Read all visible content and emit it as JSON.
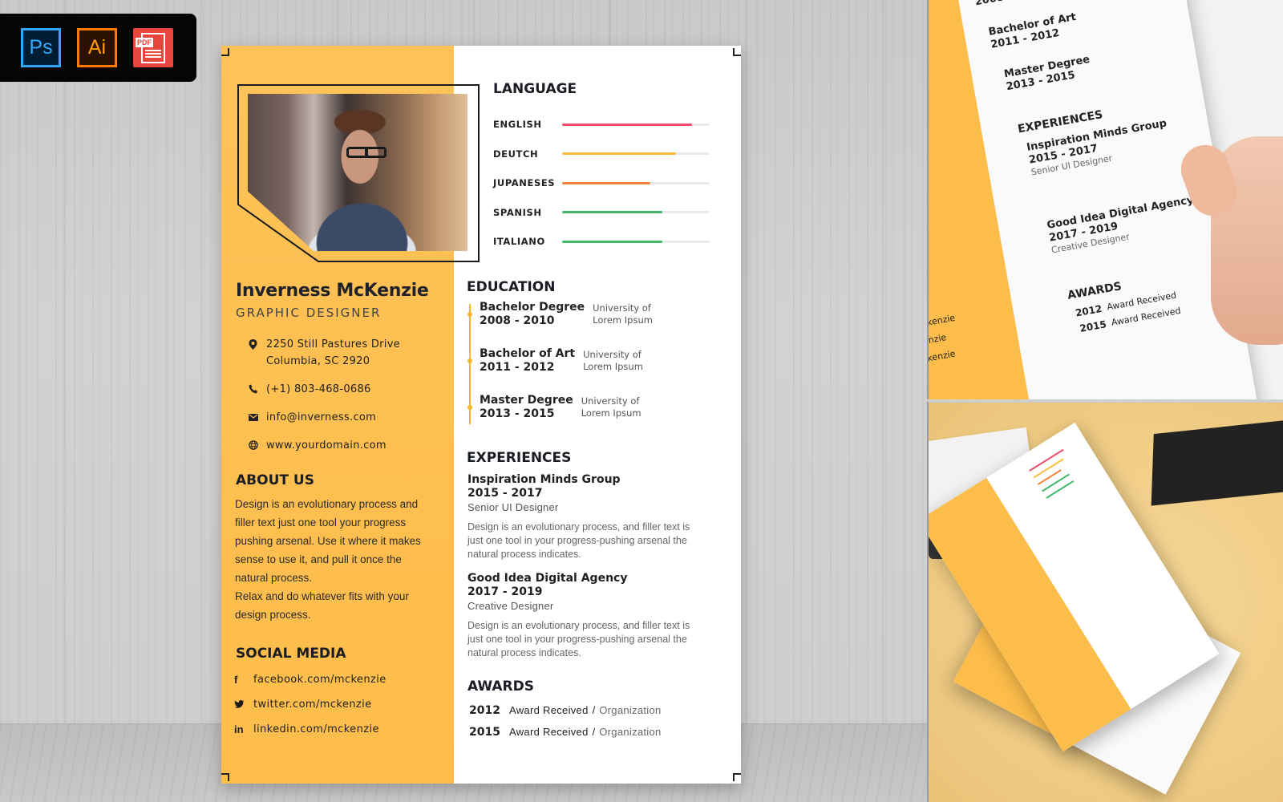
{
  "software_badges": [
    {
      "label": "Ps",
      "name": "photoshop",
      "color": "#31a8ff"
    },
    {
      "label": "Ai",
      "name": "illustrator",
      "color": "#ff9a00"
    },
    {
      "label": "PDF",
      "name": "pdf",
      "color": "#e8453c"
    }
  ],
  "resume": {
    "name": "Inverness McKenzie",
    "role": "GRAPHIC DESIGNER",
    "contact": {
      "address": "2250 Still Pastures Drive\nColumbia, SC 2920",
      "phone": "(+1) 803-468-0686",
      "email": "info@inverness.com",
      "website": "www.yourdomain.com"
    },
    "about": {
      "heading": "ABOUT US",
      "paragraph1": "Design is an evolutionary process and filler text just one tool your progress pushing arsenal. Use it where it makes sense to use it, and pull it once the natural process.",
      "paragraph2": "Relax and do whatever fits with your design process."
    },
    "social": {
      "heading": "SOCIAL MEDIA",
      "items": [
        {
          "icon": "facebook-icon",
          "glyph": "f",
          "label": "facebook.com/mckenzie"
        },
        {
          "icon": "twitter-icon",
          "glyph": "🐦",
          "label": "twitter.com/mckenzie"
        },
        {
          "icon": "linkedin-icon",
          "glyph": "in",
          "label": "linkedin.com/mckenzie"
        }
      ]
    },
    "language": {
      "heading": "LANGUAGE",
      "items": [
        {
          "label": "ENGLISH",
          "level": 0.88,
          "color": "#ee4e6e"
        },
        {
          "label": "DEUTCH",
          "level": 0.77,
          "color": "#fbbd3b"
        },
        {
          "label": "JUPANESES",
          "level": 0.6,
          "color": "#f58235"
        },
        {
          "label": "SPANISH",
          "level": 0.68,
          "color": "#3fb86a"
        },
        {
          "label": "ITALIANO",
          "level": 0.68,
          "color": "#3fb86a"
        }
      ]
    },
    "education": {
      "heading": "EDUCATION",
      "items": [
        {
          "degree": "Bachelor Degree",
          "years": "2008 - 2010",
          "school": "University of\nLorem Ipsum"
        },
        {
          "degree": "Bachelor of Art",
          "years": "2011 - 2012",
          "school": "University of\nLorem Ipsum"
        },
        {
          "degree": "Master Degree",
          "years": "2013 - 2015",
          "school": "University of\nLorem Ipsum"
        }
      ]
    },
    "experiences": {
      "heading": "EXPERIENCES",
      "items": [
        {
          "company": "Inspiration Minds Group",
          "years": "2015 - 2017",
          "role": "Senior UI Designer",
          "description": "Design is an evolutionary process, and filler text is just one tool in your progress-pushing arsenal the natural process indicates."
        },
        {
          "company": "Good Idea Digital Agency",
          "years": "2017 - 2019",
          "role": "Creative Designer",
          "description": "Design is an evolutionary process, and filler text is just one tool in your progress-pushing arsenal the natural process indicates."
        }
      ]
    },
    "awards": {
      "heading": "AWARDS",
      "separator": "/",
      "items": [
        {
          "year": "2012",
          "name": "Award Received",
          "org": "Organization"
        },
        {
          "year": "2015",
          "name": "Award Received",
          "org": "Organization"
        }
      ]
    }
  },
  "colors": {
    "accent_yellow": "#fdbd4b",
    "heading_dark": "#1a1c24"
  }
}
